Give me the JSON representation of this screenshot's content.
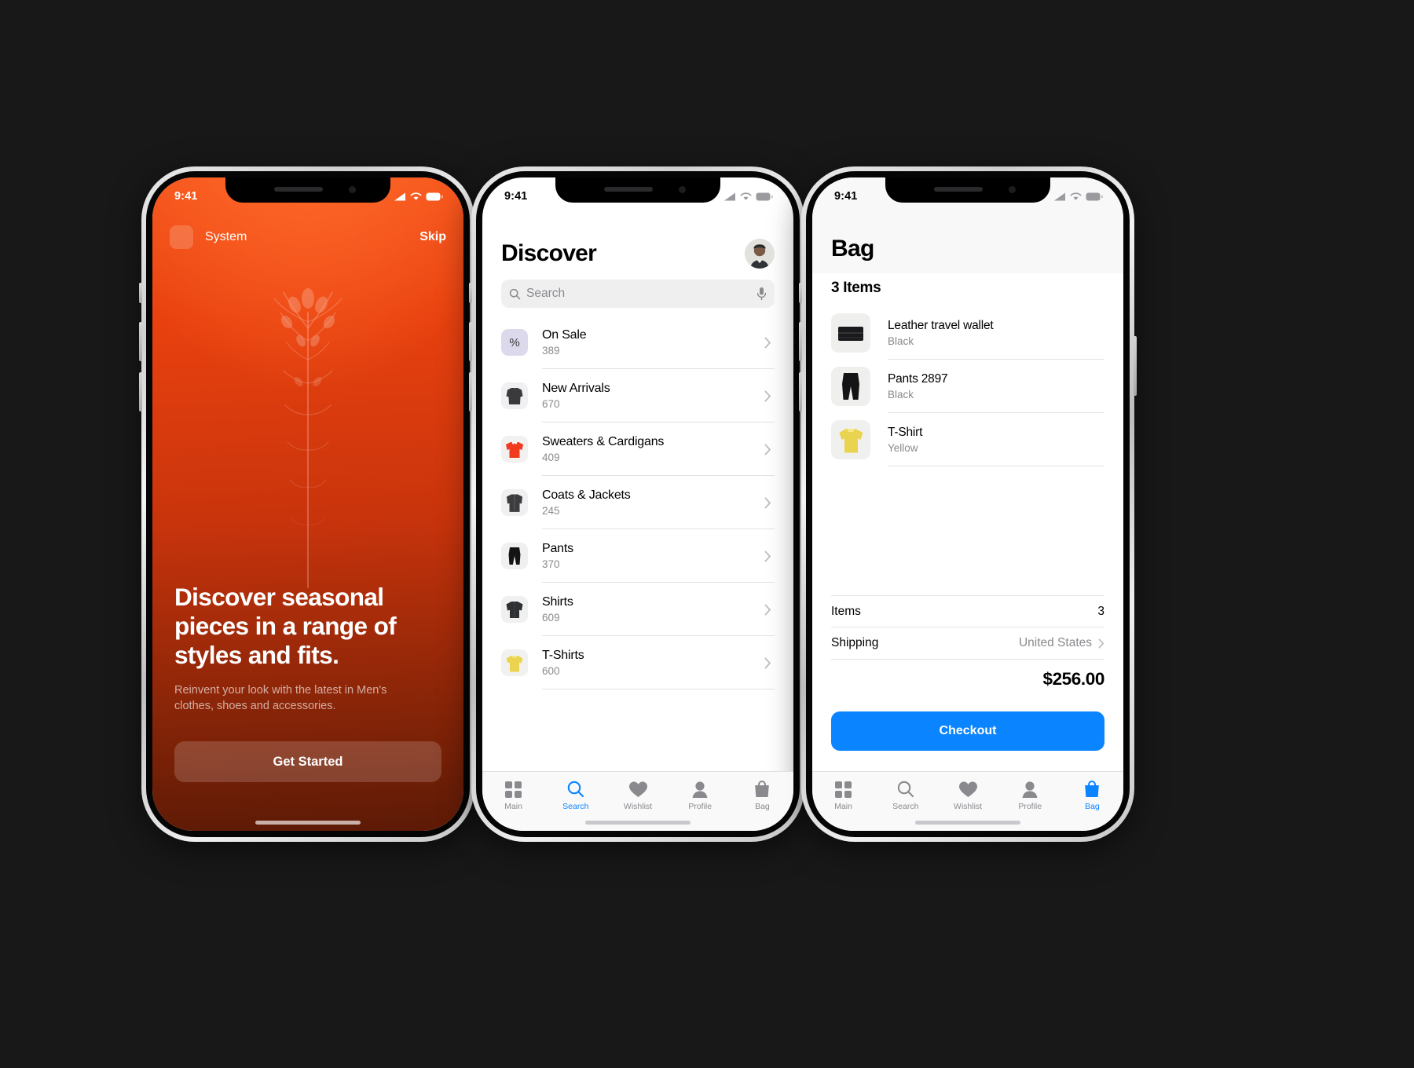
{
  "theme": {
    "background": "#181818",
    "accent_blue": "#0a84ff",
    "orange_top": "#f4521a",
    "orange_bottom": "#5c1a06",
    "muted_text": "#8a8a8e"
  },
  "phone1": {
    "status": {
      "time": "9:41",
      "icons": [
        "cellular-icon",
        "wifi-icon",
        "battery-icon"
      ]
    },
    "app_name": "System",
    "skip_label": "Skip",
    "headline": "Discover seasonal pieces in a range of styles and fits.",
    "subtitle": "Reinvent your look with the latest in Men's clothes, shoes and accessories.",
    "cta_label": "Get Started"
  },
  "phone2": {
    "status": {
      "time": "9:41",
      "icons": [
        "cellular-icon",
        "wifi-icon",
        "battery-icon"
      ]
    },
    "title": "Discover",
    "avatar": "user-avatar",
    "search": {
      "placeholder": "Search",
      "value": "",
      "left_icon": "search-icon",
      "right_icon": "microphone-icon"
    },
    "categories": [
      {
        "name": "On Sale",
        "count": "389",
        "thumb": "percent-icon"
      },
      {
        "name": "New Arrivals",
        "count": "670",
        "thumb": "dark-jacket-thumb"
      },
      {
        "name": "Sweaters & Cardigans",
        "count": "409",
        "thumb": "red-sweater-thumb"
      },
      {
        "name": "Coats & Jackets",
        "count": "245",
        "thumb": "dark-coat-thumb"
      },
      {
        "name": "Pants",
        "count": "370",
        "thumb": "black-pants-thumb"
      },
      {
        "name": "Shirts",
        "count": "609",
        "thumb": "dark-shirt-thumb"
      },
      {
        "name": "T-Shirts",
        "count": "600",
        "thumb": "yellow-tshirt-thumb"
      }
    ],
    "tabs": [
      {
        "label": "Main",
        "icon": "grid-icon",
        "active": false
      },
      {
        "label": "Search",
        "icon": "search-icon",
        "active": true
      },
      {
        "label": "Wishlist",
        "icon": "heart-icon",
        "active": false
      },
      {
        "label": "Profile",
        "icon": "person-icon",
        "active": false
      },
      {
        "label": "Bag",
        "icon": "bag-icon",
        "active": false
      }
    ]
  },
  "phone3": {
    "status": {
      "time": "9:41",
      "icons": [
        "cellular-icon",
        "wifi-icon",
        "battery-icon"
      ]
    },
    "title": "Bag",
    "items_heading": "3 Items",
    "items": [
      {
        "name": "Leather travel wallet",
        "color": "Black",
        "thumb": "black-wallet-thumb"
      },
      {
        "name": "Pants 2897",
        "color": "Black",
        "thumb": "black-pants-thumb"
      },
      {
        "name": "T-Shirt",
        "color": "Yellow",
        "thumb": "yellow-tshirt-thumb"
      }
    ],
    "summary": [
      {
        "label": "Items",
        "value": "3",
        "muted": false,
        "chevron": false
      },
      {
        "label": "Shipping",
        "value": "United States",
        "muted": true,
        "chevron": true
      }
    ],
    "total": "$256.00",
    "checkout_label": "Checkout",
    "tabs": [
      {
        "label": "Main",
        "icon": "grid-icon",
        "active": false
      },
      {
        "label": "Search",
        "icon": "search-icon",
        "active": false
      },
      {
        "label": "Wishlist",
        "icon": "heart-icon",
        "active": false
      },
      {
        "label": "Profile",
        "icon": "person-icon",
        "active": false
      },
      {
        "label": "Bag",
        "icon": "bag-icon",
        "active": true
      }
    ]
  }
}
